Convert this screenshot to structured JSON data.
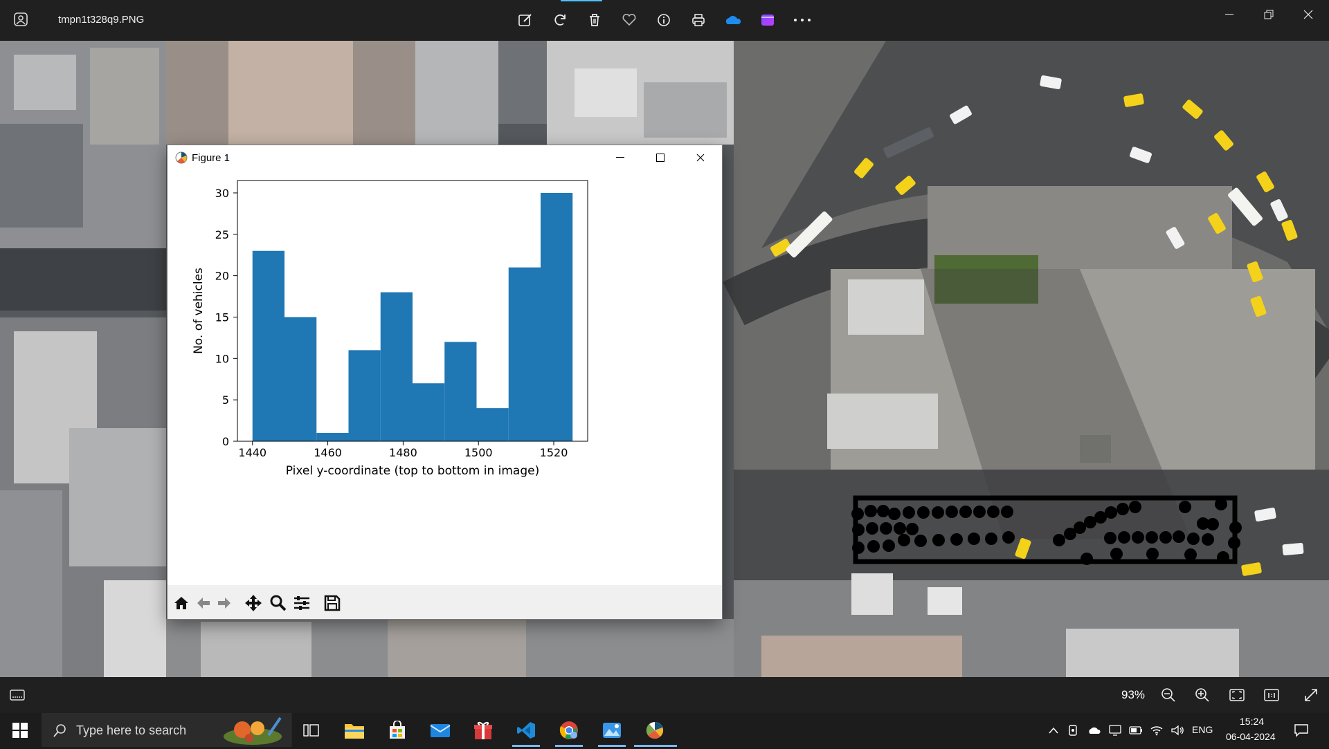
{
  "viewer": {
    "file_title": "tmpn1t328q9.PNG",
    "zoom": "93%",
    "toolbar_icons": [
      "edit-icon",
      "rotate-icon",
      "delete-icon",
      "favorite-icon",
      "info-icon",
      "print-icon",
      "onedrive-icon",
      "clipchamp-icon",
      "more-icon"
    ]
  },
  "figure": {
    "window_title": "Figure 1",
    "toolbar_icons": [
      "home-icon",
      "back-icon",
      "forward-icon",
      "pan-icon",
      "zoom-icon",
      "configure-subplots-icon",
      "save-icon"
    ]
  },
  "chart_data": {
    "type": "bar",
    "title": "",
    "xlabel": "Pixel y-coordinate (top to bottom in image)",
    "ylabel": "No. of vehicles",
    "xlim": [
      1436,
      1529
    ],
    "ylim": [
      0,
      31.5
    ],
    "xticks": [
      1440,
      1460,
      1480,
      1500,
      1520
    ],
    "yticks": [
      0,
      5,
      10,
      15,
      20,
      25,
      30
    ],
    "bin_edges": [
      1440,
      1448.5,
      1457,
      1465.5,
      1474,
      1482.5,
      1491,
      1499.5,
      1508,
      1516.5,
      1525
    ],
    "values": [
      23,
      15,
      1,
      11,
      18,
      7,
      12,
      4,
      21,
      30
    ],
    "color": "#1f77b4"
  },
  "taskbar": {
    "search_placeholder": "Type here to search",
    "language": "ENG",
    "time": "15:24",
    "date": "06-04-2024"
  }
}
